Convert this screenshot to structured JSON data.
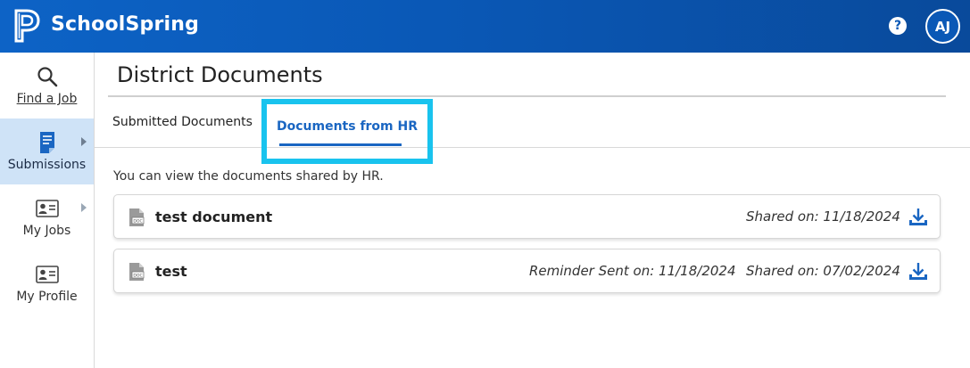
{
  "header": {
    "brand": "SchoolSpring",
    "help_symbol": "?",
    "avatar_initials": "AJ",
    "colors": {
      "primary": "#0a58b6",
      "accent": "#19c3ee"
    }
  },
  "sidebar": {
    "items": [
      {
        "label": "Find a Job",
        "icon": "search-icon",
        "active": false
      },
      {
        "label": "Submissions",
        "icon": "document-icon",
        "active": true
      },
      {
        "label": "My Jobs",
        "icon": "id-card-icon",
        "active": false
      },
      {
        "label": "My Profile",
        "icon": "id-card-icon",
        "active": false
      }
    ]
  },
  "main": {
    "title": "District Documents",
    "tabs": [
      {
        "label": "Submitted Documents",
        "active": false
      },
      {
        "label": "Documents from HR",
        "active": true
      }
    ],
    "intro": "You can view the documents shared by HR.",
    "documents": [
      {
        "name": "test document",
        "reminder": "",
        "shared": "Shared on: 11/18/2024"
      },
      {
        "name": "test",
        "reminder": "Reminder Sent on: 11/18/2024",
        "shared": "Shared on: 07/02/2024"
      }
    ]
  }
}
